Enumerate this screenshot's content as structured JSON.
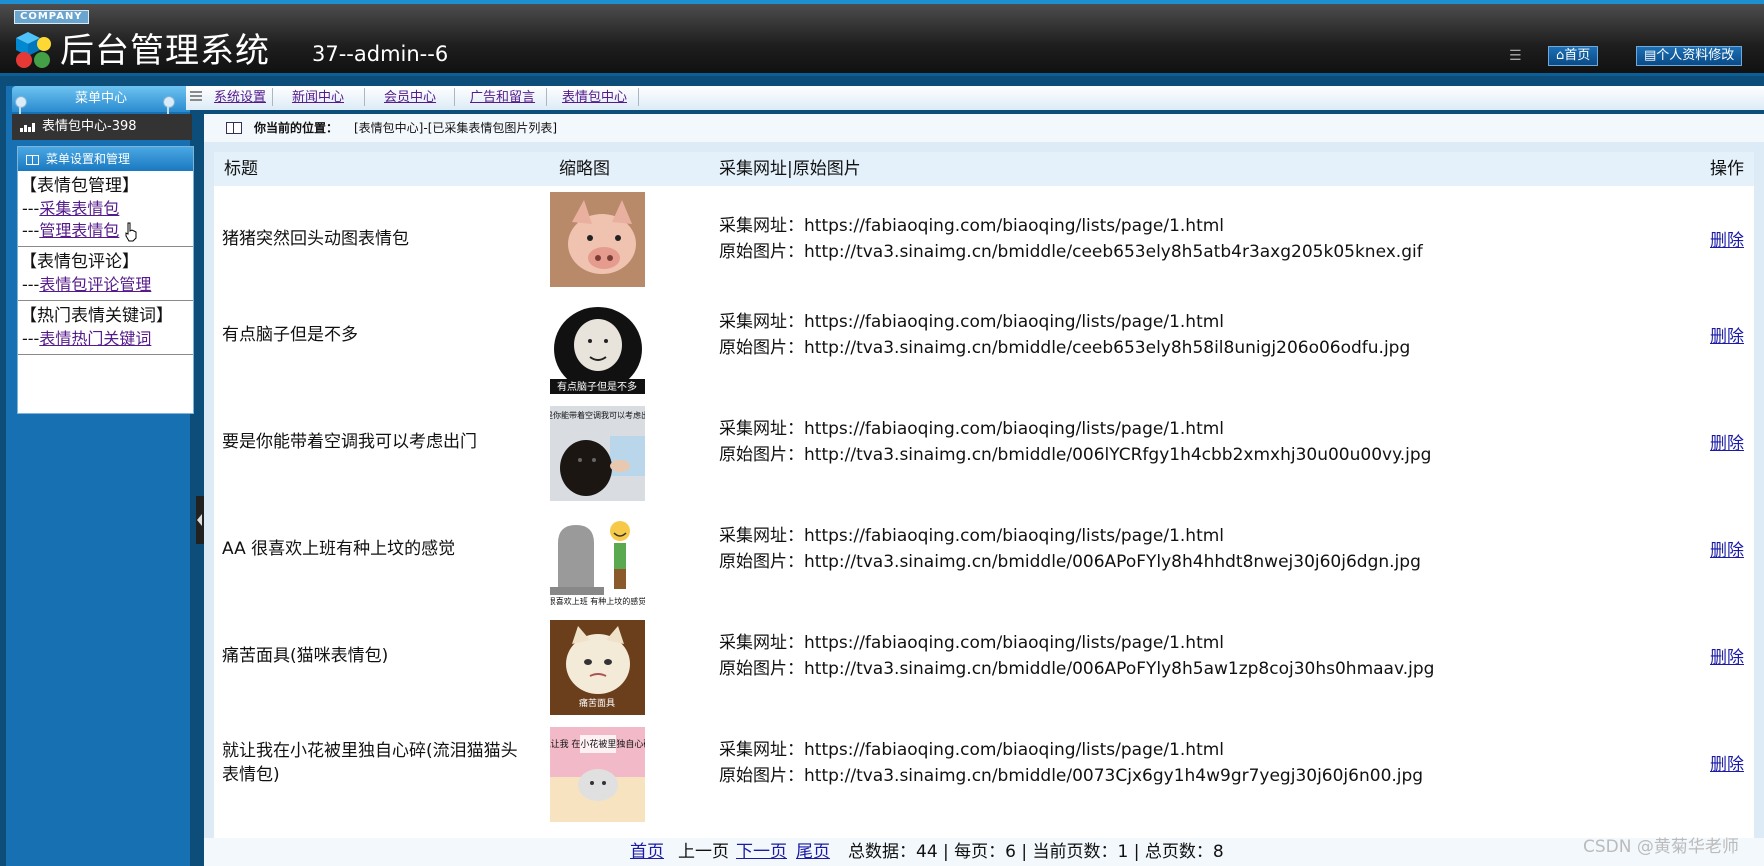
{
  "header": {
    "company": "COMPANY",
    "title": "后台管理系统",
    "user": "37--admin--6",
    "home_btn": "首页",
    "profile_btn": "个人资料修改"
  },
  "sidebar": {
    "menu_center": "菜单中心",
    "section": "表情包中心-398",
    "panel_title": "菜单设置和管理",
    "groups": [
      {
        "title": "【表情包管理】",
        "items": [
          "采集表情包",
          "管理表情包"
        ]
      },
      {
        "title": "【表情包评论】",
        "items": [
          "表情包评论管理"
        ]
      },
      {
        "title": "【热门表情关键词】",
        "items": [
          "表情热门关键词"
        ]
      }
    ],
    "item_prefix": "---"
  },
  "topnav": {
    "items": [
      "系统设置",
      "新闻中心",
      "会员中心",
      "广告和留言",
      "表情包中心"
    ]
  },
  "location": {
    "label": "你当前的位置：",
    "path": "[表情包中心]-[已采集表情包图片列表]"
  },
  "table": {
    "headers": [
      "标题",
      "缩略图",
      "采集网址|原始图片",
      "操作"
    ],
    "url_prefix": "采集网址：",
    "img_prefix": "原始图片：",
    "rows": [
      {
        "title": "猪猪突然回头动图表情包",
        "url": "https://fabiaoqing.com/biaoqing/lists/page/1.html",
        "img": "http://tva3.sinaimg.cn/bmiddle/ceeb653ely8h5atb4r3axg205k05knex.gif",
        "op": "删除"
      },
      {
        "title": "有点脑子但是不多",
        "url": "https://fabiaoqing.com/biaoqing/lists/page/1.html",
        "img": "http://tva3.sinaimg.cn/bmiddle/ceeb653ely8h58il8unigj206o06odfu.jpg",
        "op": "删除",
        "thumb_text": "有点脑子但是不多"
      },
      {
        "title": "要是你能带着空调我可以考虑出门",
        "url": "https://fabiaoqing.com/biaoqing/lists/page/1.html",
        "img": "http://tva3.sinaimg.cn/bmiddle/006lYCRfgy1h4cbb2xmxhj30u00u00vy.jpg",
        "op": "删除",
        "thumb_text": "要是你能带着空调我可以考虑出门"
      },
      {
        "title": "AA 很喜欢上班有种上坟的感觉",
        "url": "https://fabiaoqing.com/biaoqing/lists/page/1.html",
        "img": "http://tva3.sinaimg.cn/bmiddle/006APoFYly8h4hhdt8nwej30j60j6dgn.jpg",
        "op": "删除",
        "thumb_text": "很喜欢上班 有种上坟的感觉"
      },
      {
        "title": "痛苦面具(猫咪表情包)",
        "url": "https://fabiaoqing.com/biaoqing/lists/page/1.html",
        "img": "http://tva3.sinaimg.cn/bmiddle/006APoFYly8h5aw1zp8coj30hs0hmaav.jpg",
        "op": "删除",
        "thumb_text": "痛苦面具"
      },
      {
        "title": "就让我在小花被里独自心碎(流泪猫猫头表情包)",
        "url": "https://fabiaoqing.com/biaoqing/lists/page/1.html",
        "img": "http://tva3.sinaimg.cn/bmiddle/0073Cjx6gy1h4w9gr7yegj30j60j6n00.jpg",
        "op": "删除",
        "thumb_text": "就让我 在小花被里独自心碎"
      }
    ]
  },
  "pager": {
    "first": "首页",
    "prev": "上一页",
    "next": "下一页",
    "last": "尾页",
    "summary": "总数据：44 | 每页：6 | 当前页数：1 | 总页数：8"
  },
  "watermark": "CSDN @黄菊华老师"
}
